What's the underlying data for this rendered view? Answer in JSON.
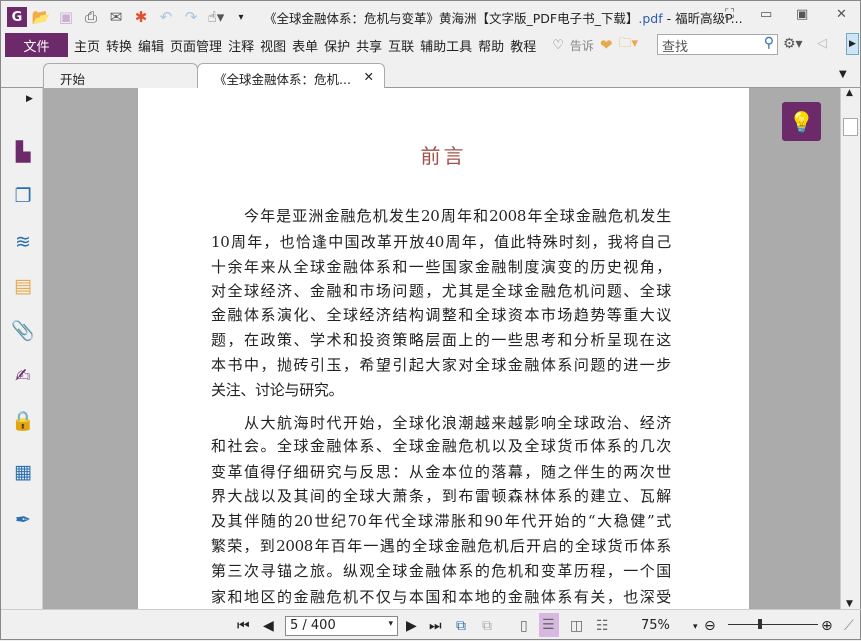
{
  "titlebar": {
    "title_main": "《全球金融体系：危机与变革》黄海洲【文字版_PDF电子书_下载】",
    "title_ext": ".pdf",
    "title_app": " - 福昕高级P..."
  },
  "menubar": {
    "file": "文件",
    "items": [
      "主页",
      "转换",
      "编辑",
      "页面管理",
      "注释",
      "视图",
      "表单",
      "保护",
      "共享",
      "互联",
      "辅助工具",
      "帮助",
      "教程"
    ],
    "tell": "告诉",
    "search_placeholder": "查找"
  },
  "tabs": [
    {
      "label": "开始"
    },
    {
      "label": "《全球金融体系：危机..."
    }
  ],
  "document": {
    "heading": "前言",
    "paragraphs": [
      [
        "今年是亚洲金融危机发生20周年和2008年全球金融危机发生",
        "10周年，也恰逢中国改革开放40周年，值此特殊时刻，我将自己",
        "十余年来从全球金融体系和一些国家金融制度演变的历史视角，",
        "对全球经济、金融和市场问题，尤其是全球金融危机问题、全球",
        "金融体系演化、全球经济结构调整和全球资本市场趋势等重大议",
        "题，在政策、学术和投资策略层面上的一些思考和分析呈现在这",
        "本书中，抛砖引玉，希望引起大家对全球金融体系问题的进一步",
        "关注、讨论与研究。"
      ],
      [
        "从大航海时代开始，全球化浪潮越来越影响全球政治、经济",
        "和社会。全球金融体系、全球金融危机以及全球货币体系的几次",
        "变革值得仔细研究与反思：从金本位的落幕，随之伴生的两次世",
        "界大战以及其间的全球大萧条，到布雷顿森林体系的建立、瓦解",
        "及其伴随的20世纪70年代全球滞胀和90年代开始的“大稳健”式",
        "繁荣，到2008年百年一遇的全球金融危机后开启的全球货币体系",
        "第三次寻锚之旅。纵观全球金融体系的危机和变革历程，一个国",
        "家和地区的金融危机不仅与本国和本地的金融体系有关，也深受"
      ]
    ]
  },
  "status": {
    "page": "5 / 400",
    "zoom": "75%"
  },
  "colors": {
    "brand": "#6c2a6a",
    "heading": "#a0524a"
  }
}
